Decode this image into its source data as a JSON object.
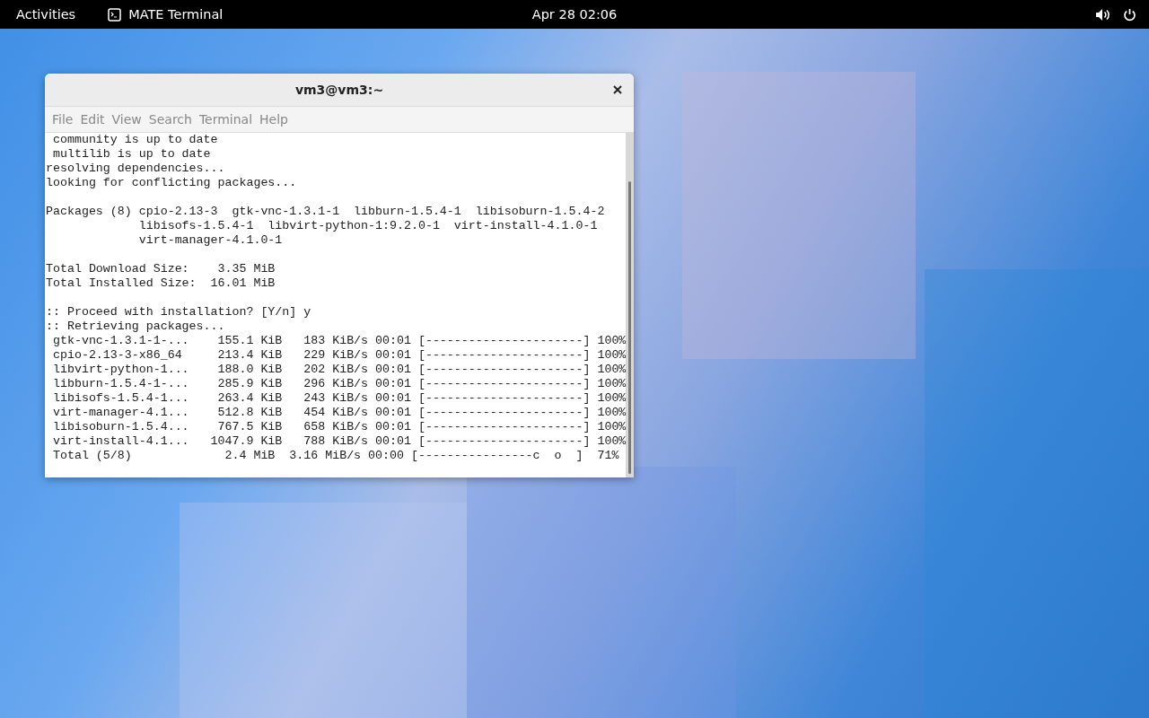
{
  "top_bar": {
    "activities": "Activities",
    "app_name": "MATE Terminal",
    "clock": "Apr 28  02:06"
  },
  "window": {
    "title": "vm3@vm3:~",
    "menu": [
      "File",
      "Edit",
      "View",
      "Search",
      "Terminal",
      "Help"
    ],
    "terminal_blocks": [
      [
        " community is up to date",
        " multilib is up to date",
        "resolving dependencies...",
        "looking for conflicting packages..."
      ],
      [
        "Packages (8) cpio-2.13-3  gtk-vnc-1.3.1-1  libburn-1.5.4-1  libisoburn-1.5.4-2",
        "             libisofs-1.5.4-1  libvirt-python-1:9.2.0-1  virt-install-4.1.0-1",
        "             virt-manager-4.1.0-1"
      ],
      [
        "Total Download Size:    3.35 MiB",
        "Total Installed Size:  16.01 MiB"
      ],
      [
        ":: Proceed with installation? [Y/n] y",
        ":: Retrieving packages...",
        " gtk-vnc-1.3.1-1-...    155.1 KiB   183 KiB/s 00:01 [----------------------] 100%",
        " cpio-2.13-3-x86_64     213.4 KiB   229 KiB/s 00:01 [----------------------] 100%",
        " libvirt-python-1...    188.0 KiB   202 KiB/s 00:01 [----------------------] 100%",
        " libburn-1.5.4-1-...    285.9 KiB   296 KiB/s 00:01 [----------------------] 100%",
        " libisofs-1.5.4-1...    263.4 KiB   243 KiB/s 00:01 [----------------------] 100%",
        " virt-manager-4.1...    512.8 KiB   454 KiB/s 00:01 [----------------------] 100%",
        " libisoburn-1.5.4...    767.5 KiB   658 KiB/s 00:01 [----------------------] 100%",
        " virt-install-4.1...   1047.9 KiB   788 KiB/s 00:01 [----------------------] 100%",
        " Total (5/8)             2.4 MiB  3.16 MiB/s 00:00 [----------------c  o  ]  71%"
      ]
    ]
  }
}
